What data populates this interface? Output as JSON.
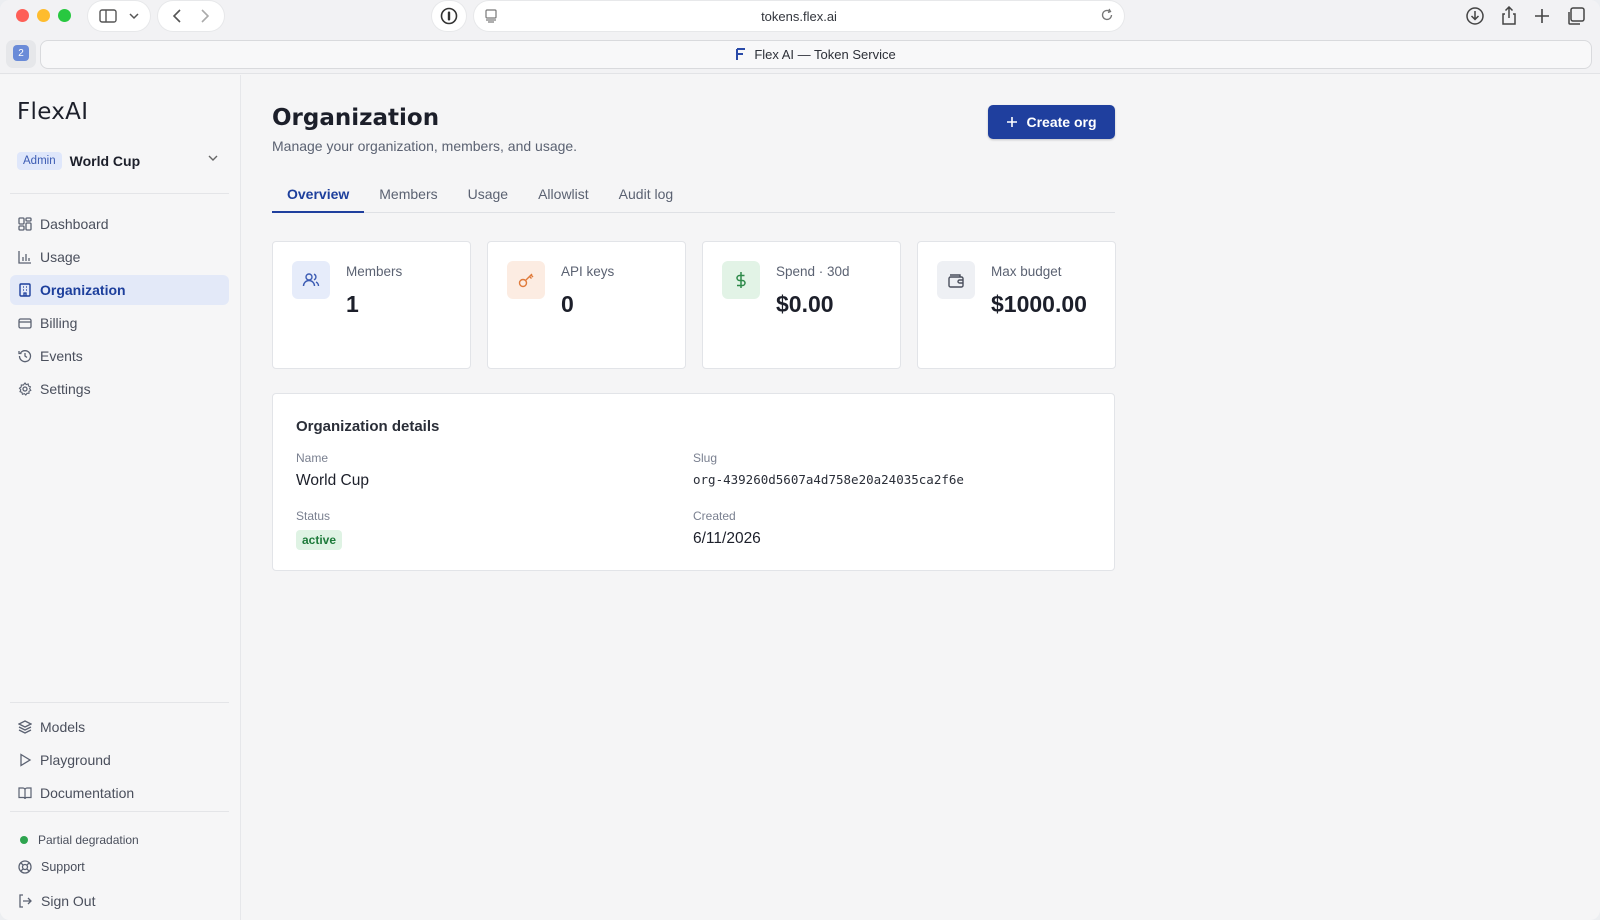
{
  "browser": {
    "url": "tokens.flex.ai",
    "tab_title": "Flex AI — Token Service",
    "tab_count": "2"
  },
  "sidebar": {
    "logo": "FlexAI",
    "role_badge": "Admin",
    "org_name": "World Cup",
    "nav": [
      {
        "label": "Dashboard",
        "icon": "dashboard-icon"
      },
      {
        "label": "Usage",
        "icon": "bar-chart-icon"
      },
      {
        "label": "Organization",
        "icon": "building-icon",
        "active": true
      },
      {
        "label": "Billing",
        "icon": "credit-card-icon"
      },
      {
        "label": "Events",
        "icon": "history-icon"
      },
      {
        "label": "Settings",
        "icon": "gear-icon"
      }
    ],
    "secondary": [
      {
        "label": "Models",
        "icon": "layers-icon"
      },
      {
        "label": "Playground",
        "icon": "play-icon"
      },
      {
        "label": "Documentation",
        "icon": "book-icon"
      }
    ],
    "status": "Partial degradation",
    "status_color": "#2ea44f",
    "support": "Support",
    "sign_out": "Sign Out"
  },
  "main": {
    "title": "Organization",
    "subtitle": "Manage your organization, members, and usage.",
    "create_button": "Create org",
    "tabs": [
      "Overview",
      "Members",
      "Usage",
      "Allowlist",
      "Audit log"
    ],
    "active_tab": "Overview",
    "stats": [
      {
        "label": "Members",
        "value": "1",
        "icon": "users-icon"
      },
      {
        "label": "API keys",
        "value": "0",
        "icon": "key-icon"
      },
      {
        "label": "Spend · 30d",
        "value": "$0.00",
        "icon": "dollar-icon"
      },
      {
        "label": "Max budget",
        "value": "$1000.00",
        "icon": "wallet-icon"
      }
    ],
    "details": {
      "heading": "Organization details",
      "name_label": "Name",
      "name_value": "World Cup",
      "slug_label": "Slug",
      "slug_value": "org-439260d5607a4d758e20a24035ca2f6e",
      "status_label": "Status",
      "status_value": "active",
      "created_label": "Created",
      "created_value": "6/11/2026"
    }
  },
  "colors": {
    "accent": "#1f3f9e",
    "active_nav_bg": "#e3e9f8",
    "status_green": "#2ea44f"
  }
}
